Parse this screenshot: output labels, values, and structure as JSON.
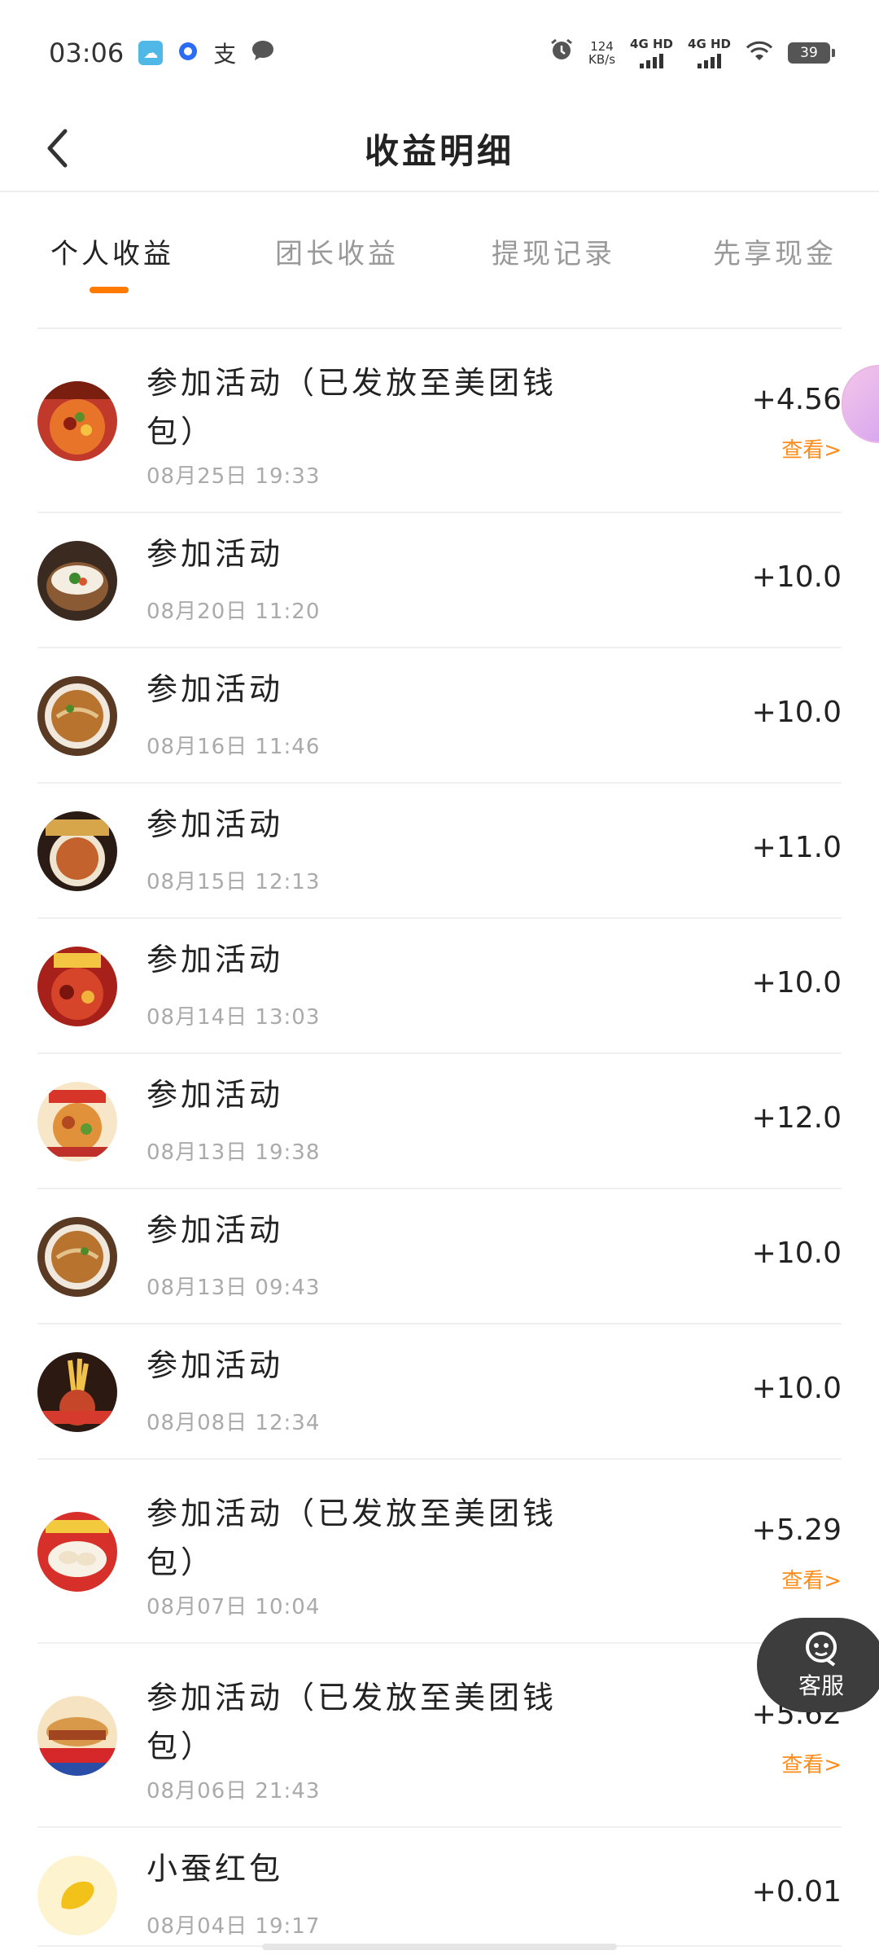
{
  "status_bar": {
    "time": "03:06",
    "speed_value": "124",
    "speed_unit": "KB/s",
    "net1": "4G HD",
    "net2": "4G HD",
    "battery": "39",
    "app_icons": [
      "sky-icon",
      "blue-dot-icon",
      "alipay-icon",
      "chat-bubble-icon"
    ]
  },
  "header": {
    "title": "收益明细",
    "back_icon": "chevron-left-icon"
  },
  "tabs": [
    {
      "label": "个人收益",
      "active": true
    },
    {
      "label": "团长收益",
      "active": false
    },
    {
      "label": "提现记录",
      "active": false
    },
    {
      "label": "先享现金",
      "active": false
    }
  ],
  "colors": {
    "accent": "#ff7a00",
    "view_link": "#ff8c1a",
    "time_text": "#aaaaaa",
    "service_button": "#3d3d3d"
  },
  "records": [
    {
      "title": "参加活动（已发放至美团钱包）",
      "time": "08月25日  19:33",
      "amount": "+4.56",
      "view": "查看>"
    },
    {
      "title": "参加活动",
      "time": "08月20日  11:20",
      "amount": "+10.0"
    },
    {
      "title": "参加活动",
      "time": "08月16日  11:46",
      "amount": "+10.0"
    },
    {
      "title": "参加活动",
      "time": "08月15日  12:13",
      "amount": "+11.0"
    },
    {
      "title": "参加活动",
      "time": "08月14日  13:03",
      "amount": "+10.0"
    },
    {
      "title": "参加活动",
      "time": "08月13日  19:38",
      "amount": "+12.0"
    },
    {
      "title": "参加活动",
      "time": "08月13日  09:43",
      "amount": "+10.0"
    },
    {
      "title": "参加活动",
      "time": "08月08日  12:34",
      "amount": "+10.0"
    },
    {
      "title": "参加活动（已发放至美团钱包）",
      "time": "08月07日  10:04",
      "amount": "+5.29",
      "view": "查看>"
    },
    {
      "title": "参加活动（已发放至美团钱包）",
      "time": "08月06日  21:43",
      "amount": "+5.62",
      "view": "查看>"
    },
    {
      "title": "小蚕红包",
      "time": "08月04日  19:17",
      "amount": "+0.01"
    }
  ],
  "customer_service": {
    "label": "客服",
    "icon": "headset-face-icon"
  }
}
